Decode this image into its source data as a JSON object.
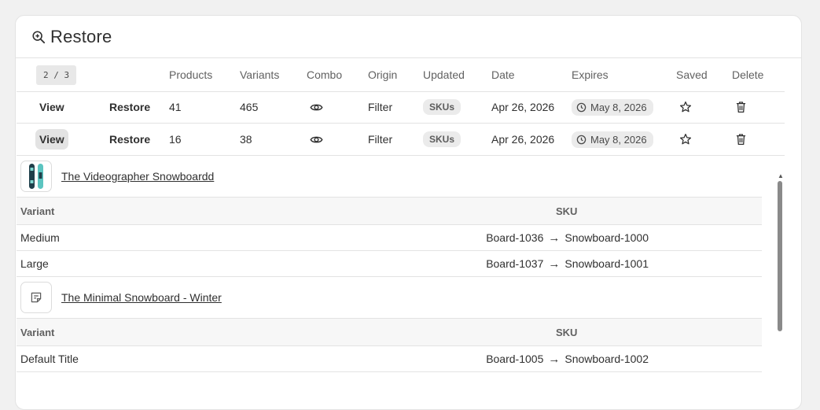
{
  "header": {
    "title": "Restore",
    "icon": "search-zoom-icon"
  },
  "table": {
    "pager": "2 / 3",
    "columns": {
      "products": "Products",
      "variants": "Variants",
      "combo": "Combo",
      "origin": "Origin",
      "updated": "Updated",
      "date": "Date",
      "expires": "Expires",
      "saved": "Saved",
      "delete": "Delete"
    },
    "rows": [
      {
        "view": "View",
        "restore": "Restore",
        "products": "41",
        "variants": "465",
        "origin": "Filter",
        "updated": "SKUs",
        "date": "Apr 26, 2026",
        "expires": "May 8, 2026"
      },
      {
        "view": "View",
        "restore": "Restore",
        "products": "16",
        "variants": "38",
        "origin": "Filter",
        "updated": "SKUs",
        "date": "Apr 26, 2026",
        "expires": "May 8, 2026"
      }
    ]
  },
  "detail": {
    "variant_header": "Variant",
    "sku_header": "SKU",
    "products": [
      {
        "name": "The Videographer Snowboardd",
        "variants": [
          {
            "name": "Medium",
            "from": "Board-1036",
            "to": "Snowboard-1000"
          },
          {
            "name": "Large",
            "from": "Board-1037",
            "to": "Snowboard-1001"
          }
        ]
      },
      {
        "name": "The Minimal Snowboard - Winter",
        "variants": [
          {
            "name": "Default Title",
            "from": "Board-1005",
            "to": "Snowboard-1002"
          }
        ]
      }
    ]
  },
  "colors": {
    "background": "#f1f1f1",
    "card": "#ffffff",
    "border": "#e3e3e3",
    "badge": "#ebebeb",
    "text": "#303030"
  }
}
